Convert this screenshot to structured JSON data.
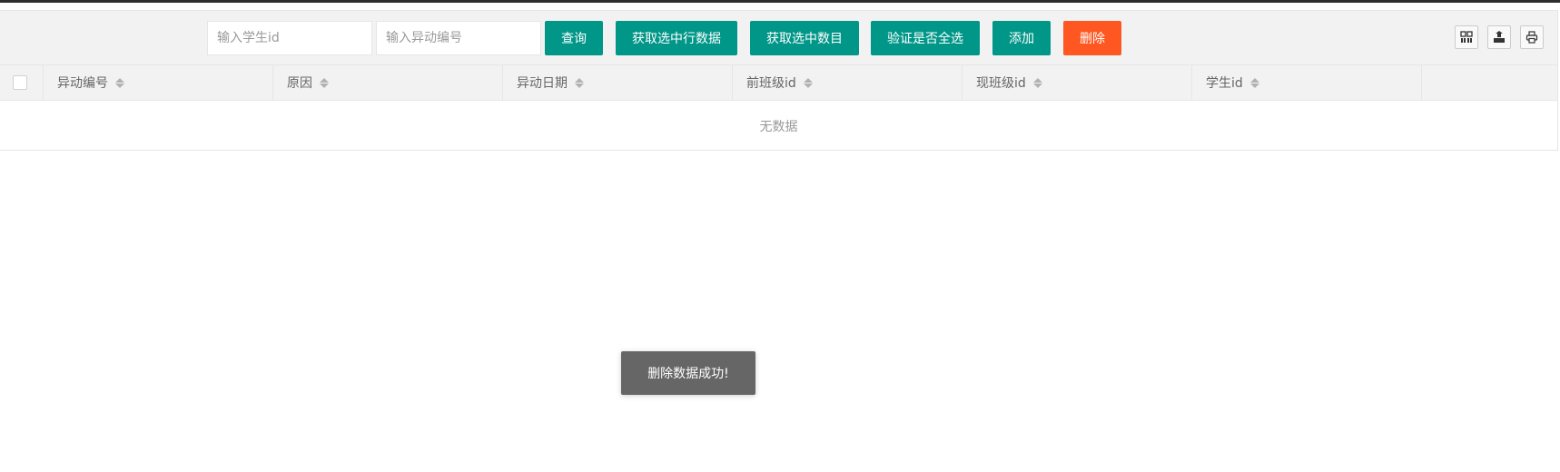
{
  "toolbar": {
    "student_id_placeholder": "输入学生id",
    "change_no_placeholder": "输入异动编号",
    "buttons": {
      "query": "查询",
      "get_selected_rows": "获取选中行数据",
      "get_selected_count": "获取选中数目",
      "check_all_selected": "验证是否全选",
      "add": "添加",
      "delete": "删除"
    },
    "tool_icons": [
      "columns-icon",
      "export-icon",
      "print-icon"
    ]
  },
  "table": {
    "columns": [
      "异动编号",
      "原因",
      "异动日期",
      "前班级id",
      "现班级id",
      "学生id"
    ],
    "rows": [],
    "empty_text": "无数据"
  },
  "toast": {
    "message": "删除数据成功!"
  },
  "colors": {
    "primary": "#009688",
    "danger": "#ff5722",
    "toast_bg": "#666666",
    "header_bg": "#f2f2f2"
  }
}
